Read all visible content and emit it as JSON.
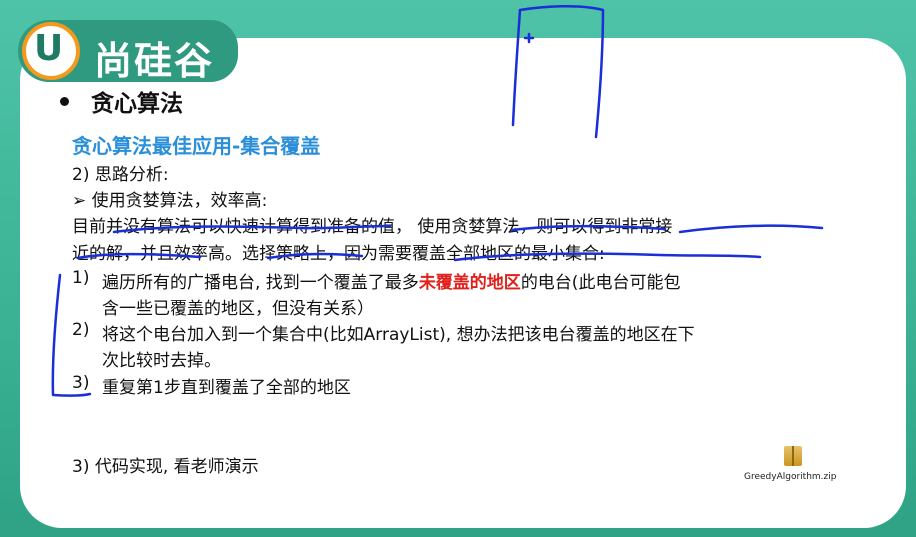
{
  "logo": {
    "mark": "U",
    "name": "尚硅谷"
  },
  "heading": "贪心算法",
  "subtitle": "贪心算法最佳应用-集合覆盖",
  "section_analysis": "2)   思路分析:",
  "method_line": "➢  使用贪婪算法，效率高:",
  "paragraph": {
    "line1": "目前并没有算法可以快速计算得到准备的值， 使用贪婪算法，则可以得到非常接",
    "line2": "近的解，并且效率高。选择策略上，因为需要覆盖全部地区的最小集合:"
  },
  "steps": [
    {
      "num": "1)",
      "line1_before": "遍历所有的广播电台, 找到一个覆盖了最多",
      "line1_highlight": "未覆盖的地区",
      "line1_after": "的电台(此电台可能包",
      "line2": "含一些已覆盖的地区，但没有关系）"
    },
    {
      "num": "2)",
      "line1": "将这个电台加入到一个集合中(比如ArrayList), 想办法把该电台覆盖的地区在下",
      "line2": "次比较时去掉。"
    },
    {
      "num": "3)",
      "line1": "重复第1步直到覆盖了全部的地区"
    }
  ],
  "code_line": "3) 代码实现, 看老师演示",
  "attachment": {
    "name": "GreedyAlgorithm.zip",
    "icon": "zip-folder-icon"
  },
  "colors": {
    "accent_blue": "#2a8fd8",
    "highlight_red": "#e0201b",
    "ink_blue": "#1a2fd6",
    "brand_green": "#3ab293"
  }
}
